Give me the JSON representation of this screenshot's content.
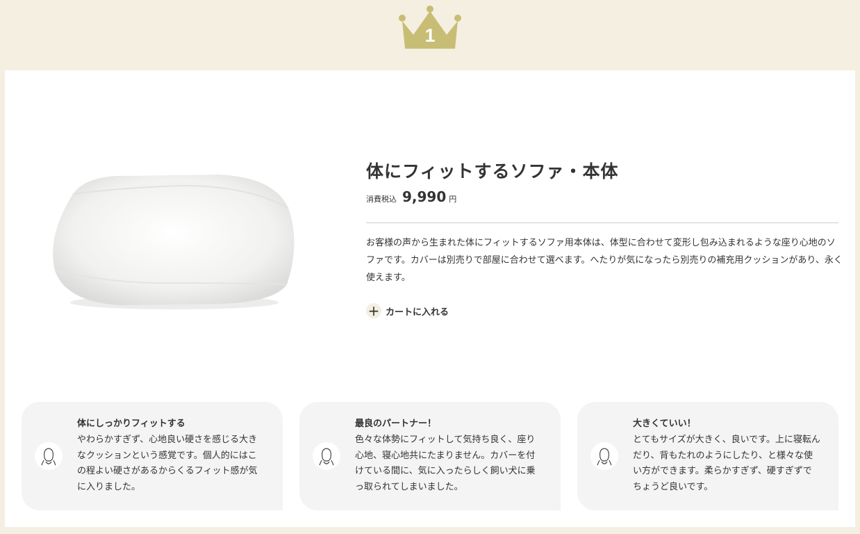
{
  "rank": {
    "number": "1",
    "crown_icon": "crown-icon",
    "color": "#c8bd74"
  },
  "product": {
    "title": "体にフィットするソファ・本体",
    "tax_label": "消費税込",
    "price": "9,990",
    "currency": "円",
    "description": "お客様の声から生まれた体にフィットするソファ用本体は、体型に合わせて変形し包み込まれるような座り心地のソファです。カバーは別売りで部屋に合わせて選べます。へたりが気になったら別売りの補充用クッションがあり、永く使えます。",
    "add_to_cart_label": "カートに入れる",
    "add_icon": "plus-icon"
  },
  "reviews": [
    {
      "title": "体にしっかりフィットする",
      "body": "やわらかすぎず、心地良い硬さを感じる大きなクッションという感覚です。個人的にはこの程よい硬さがあるからくるフィット感が気に入りました。",
      "avatar_icon": "user-avatar-icon"
    },
    {
      "title": "最良のパートナー！",
      "body": "色々な体勢にフィットして気持ち良く、座り心地、寝心地共にたまりません。カバーを付けている間に、気に入ったらしく飼い犬に乗っ取られてしまいました。",
      "avatar_icon": "user-avatar-icon"
    },
    {
      "title": "大きくていい！",
      "body": "とてもサイズが大きく、良いです。上に寝転んだり、背もたれのようにしたり、と様々な使い方ができます。柔らかすぎず、硬すぎずでちょうど良いです。",
      "avatar_icon": "user-avatar-icon"
    }
  ],
  "colors": {
    "background": "#f4efe1",
    "card": "#ffffff",
    "review_bg": "#f4f4f4",
    "text": "#333333"
  }
}
